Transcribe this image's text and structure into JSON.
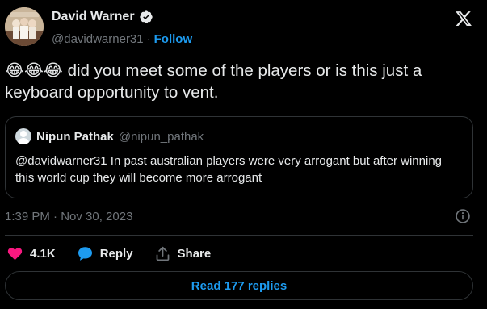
{
  "author": {
    "name": "David Warner",
    "handle": "@davidwarner31",
    "separator": "·",
    "follow_label": "Follow"
  },
  "tweet": {
    "emojis": "😂😂😂",
    "text": " did you meet some of the players or is this just a keyboard opportunity to vent."
  },
  "quote": {
    "name": "Nipun Pathak",
    "handle": "@nipun_pathak",
    "text": "@davidwarner31 In past australian players were very arrogant but after winning this world cup they will become more arrogant"
  },
  "timestamp": "1:39 PM · Nov 30, 2023",
  "actions": {
    "likes": "4.1K",
    "reply_label": "Reply",
    "share_label": "Share"
  },
  "read_replies_label": "Read 177 replies",
  "colors": {
    "background": "#000000",
    "text": "#e7e9ea",
    "muted": "#71767b",
    "accent": "#1d9bf0",
    "like": "#f91880",
    "border": "#2f3336"
  },
  "icons": [
    "verified-badge-icon",
    "x-logo-icon",
    "info-icon",
    "heart-icon",
    "reply-bubble-icon",
    "share-icon"
  ]
}
